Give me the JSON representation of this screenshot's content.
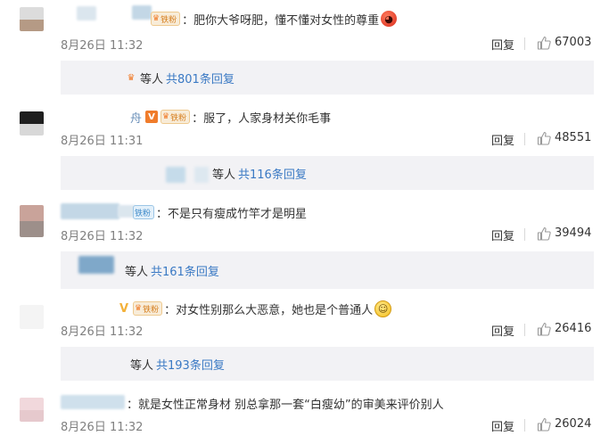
{
  "badges": {
    "fan_text": "铁粉",
    "vip_mark": "V"
  },
  "comments": [
    {
      "name_fragment": "",
      "text": "：肥你大爷呀肥，懂不懂对女性的尊重",
      "emoji": "angry-face",
      "time": "8月26日 11:32",
      "reply_label": "回复",
      "like_count": "67003",
      "reply_summary": {
        "prefix": "等人",
        "total": "共801条回复"
      }
    },
    {
      "name_fragment": "舟",
      "text": "：服了，人家身材关你毛事",
      "time": "8月26日 11:31",
      "reply_label": "回复",
      "like_count": "48551",
      "reply_summary": {
        "prefix": "等人",
        "total": "共116条回复"
      }
    },
    {
      "name_fragment": "",
      "text": "：不是只有瘦成竹竿才是明星",
      "time": "8月26日 11:32",
      "reply_label": "回复",
      "like_count": "39494",
      "reply_summary": {
        "prefix": "等人",
        "total": "共161条回复"
      }
    },
    {
      "name_fragment": "",
      "text": "：对女性别那么大恶意，她也是个普通人",
      "emoji": "smile-face",
      "time": "8月26日 11:32",
      "reply_label": "回复",
      "like_count": "26416",
      "reply_summary": {
        "prefix": "等人",
        "total": "共193条回复"
      }
    },
    {
      "name_fragment": "",
      "text": "：就是女性正常身材 别总拿那一套“白瘦幼”的审美来评价别人",
      "time": "8月26日 11:32",
      "reply_label": "回复",
      "like_count": "26024"
    }
  ],
  "colors": {
    "link_blue": "#3a79c4",
    "reply_bar_bg": "#f2f2f5",
    "meta_gray": "#808080",
    "badge_orange": "#d67e1e"
  }
}
